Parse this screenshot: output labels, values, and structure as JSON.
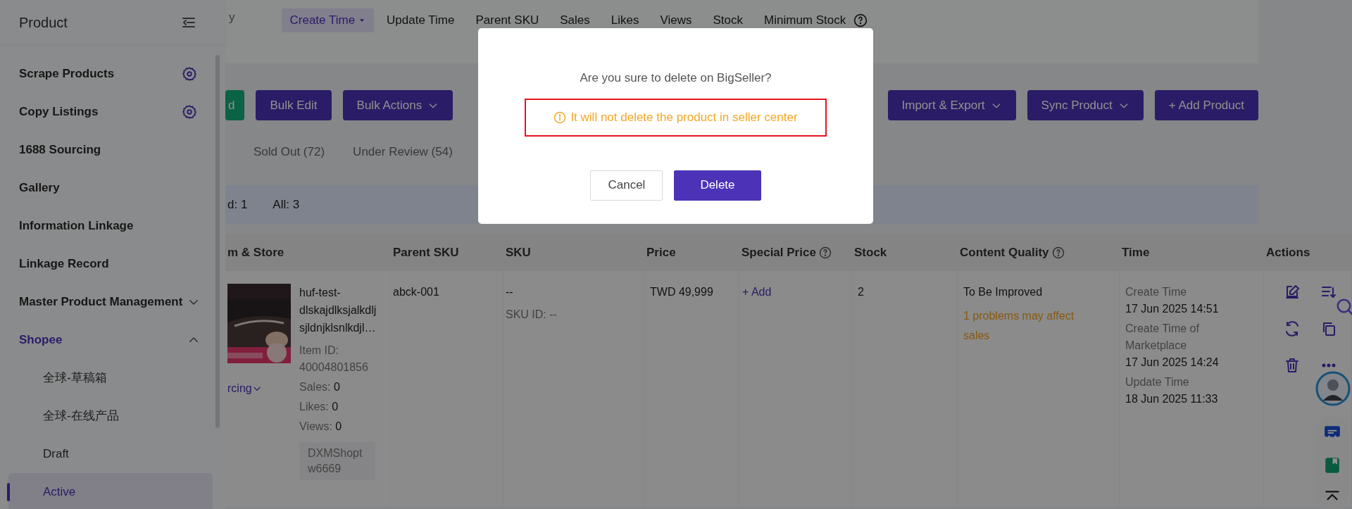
{
  "sidebar": {
    "title": "Product",
    "items": [
      {
        "label": "Scrape Products",
        "settings": true,
        "selected": false
      },
      {
        "label": "Copy Listings",
        "settings": true,
        "selected": false
      },
      {
        "label": "1688 Sourcing",
        "settings": false,
        "selected": false
      },
      {
        "label": "Gallery",
        "settings": false,
        "selected": false
      },
      {
        "label": "Information Linkage",
        "settings": false,
        "selected": false
      },
      {
        "label": "Linkage Record",
        "settings": false,
        "selected": false
      },
      {
        "label": "Master Product Management",
        "settings": false,
        "selected": false,
        "expanded": false
      },
      {
        "label": "Shopee",
        "settings": false,
        "selected": true,
        "expanded": true,
        "children": [
          {
            "label": "全球-草稿箱",
            "selected": false
          },
          {
            "label": "全球-在线产品",
            "selected": false
          },
          {
            "label": "Draft",
            "selected": false
          },
          {
            "label": "Active",
            "selected": true
          }
        ]
      }
    ]
  },
  "sort_bar": {
    "label": "y",
    "options": [
      {
        "label": "Create Time",
        "selected": true,
        "help": false
      },
      {
        "label": "Update Time",
        "selected": false,
        "help": false
      },
      {
        "label": "Parent SKU",
        "selected": false,
        "help": false
      },
      {
        "label": "Sales",
        "selected": false,
        "help": false
      },
      {
        "label": "Likes",
        "selected": false,
        "help": false
      },
      {
        "label": "Views",
        "selected": false,
        "help": false
      },
      {
        "label": "Stock",
        "selected": false,
        "help": false
      },
      {
        "label": "Minimum Stock",
        "selected": false,
        "help": true
      }
    ]
  },
  "toolbar": {
    "left": [
      {
        "label": "d",
        "kind": "success",
        "dropdown": false
      },
      {
        "label": "Bulk Edit",
        "kind": "primary",
        "dropdown": false
      },
      {
        "label": "Bulk Actions",
        "kind": "primary",
        "dropdown": true
      }
    ],
    "right": [
      {
        "label": "Import & Export",
        "kind": "primary",
        "dropdown": true
      },
      {
        "label": "Sync Product",
        "kind": "primary",
        "dropdown": true
      },
      {
        "label": "+ Add Product",
        "kind": "primary",
        "dropdown": false
      }
    ]
  },
  "tabs": [
    {
      "label": "Sold Out (72)",
      "selected": false
    },
    {
      "label": "Under Review (54)",
      "selected": false
    }
  ],
  "summary": [
    "d: 1",
    "All: 3"
  ],
  "table": {
    "columns": [
      {
        "label": "m & Store",
        "help": false
      },
      {
        "label": "Parent SKU",
        "help": false
      },
      {
        "label": "SKU",
        "help": false
      },
      {
        "label": "Price",
        "help": false
      },
      {
        "label": "Special Price",
        "help": true
      },
      {
        "label": "Stock",
        "help": false
      },
      {
        "label": "Content Quality",
        "help": true
      },
      {
        "label": "Time",
        "help": false
      },
      {
        "label": "Actions",
        "help": false
      }
    ],
    "rows": [
      {
        "product": {
          "kind": "picture",
          "name": "huf-test-dlskajdlksjalkdljsjldnjklsnlkdjl…",
          "item_id_label": "Item ID:",
          "item_id": "40004801856",
          "stats": [
            {
              "label": "Sales:",
              "value": "0"
            },
            {
              "label": "Likes:",
              "value": "0"
            },
            {
              "label": "Views:",
              "value": "0"
            }
          ],
          "store": "DXMShoptw6669",
          "source_link": "rcing"
        },
        "parent_sku": "abck-001",
        "sku": "--",
        "sku_id": "SKU ID: --",
        "price": "TWD 49,999",
        "special_price": "+ Add",
        "stock": "2",
        "quality": "To Be Improved",
        "quality_note": "1 problems may affect sales",
        "times": [
          {
            "label": "Create Time",
            "value": "17 Jun 2025 14:51"
          },
          {
            "label": "Create Time of Marketplace",
            "value": "17 Jun 2025 14:24"
          },
          {
            "label": "Update Time",
            "value": "18 Jun 2025 11:33"
          }
        ]
      }
    ]
  },
  "dialog": {
    "message": "Are you sure to delete on BigSeller?",
    "warning": "It will not delete the product in seller center",
    "buttons": [
      {
        "label": "Cancel",
        "kind": "secondary"
      },
      {
        "label": "Delete",
        "kind": "primary"
      }
    ]
  }
}
